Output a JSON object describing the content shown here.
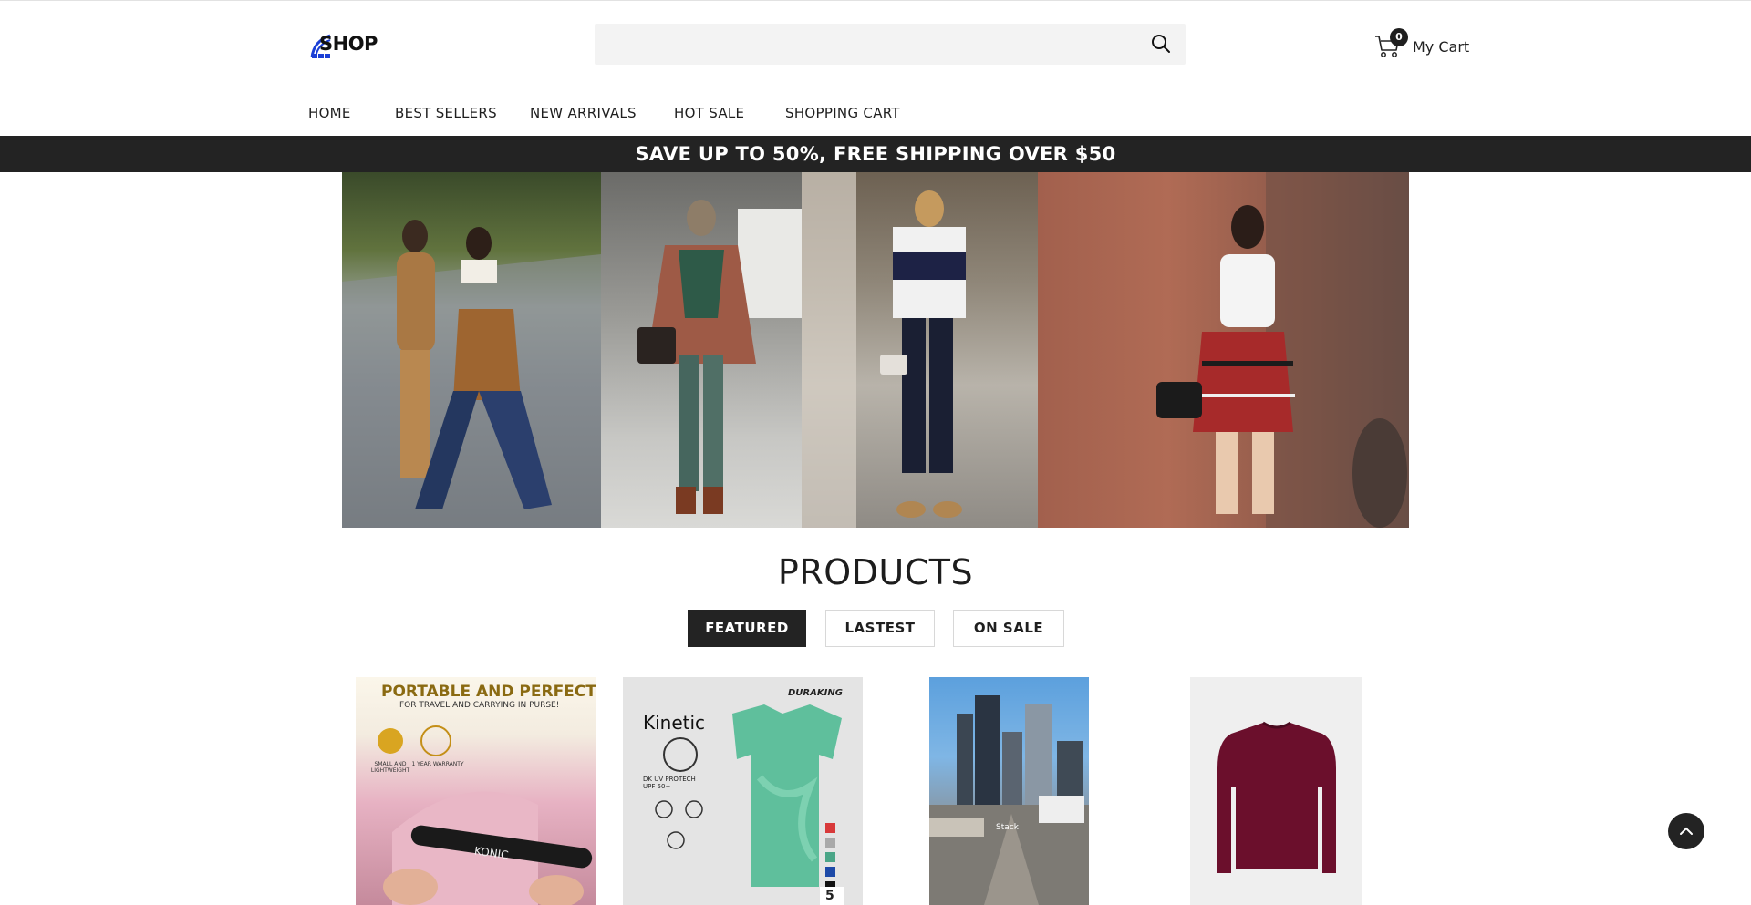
{
  "header": {
    "logo_text": "SHOP",
    "search_placeholder": "",
    "cart_count": "0",
    "cart_label": "My Cart"
  },
  "nav": {
    "items": [
      "HOME",
      "BEST SELLERS",
      "NEW ARRIVALS",
      "HOT SALE",
      "SHOPPING CART"
    ]
  },
  "promo": {
    "text": "SAVE UP TO 50%, FREE SHIPPING OVER $50"
  },
  "products": {
    "title": "PRODUCTS",
    "tabs": [
      "FEATURED",
      "LASTEST",
      "ON SALE"
    ],
    "active_tab": "FEATURED",
    "items": [
      {
        "headline": "PORTABLE AND PERFECT",
        "subline": "FOR TRAVEL AND CARRYING IN PURSE!",
        "badge_left": "SMALL AND LIGHTWEIGHT",
        "badge_right": "1 YEAR WARRANTY",
        "brand": "KONIC"
      },
      {
        "brand_top": "DURAKING",
        "brand_main": "Kinetic",
        "feature": "DK UV PROTECH UPF 50+",
        "count": "5"
      },
      {
        "sign": "Stack"
      },
      {}
    ]
  },
  "colors": {
    "promo_bg": "#232323",
    "accent": "#1f1f1f",
    "logo_blue": "#1b3fd6"
  }
}
